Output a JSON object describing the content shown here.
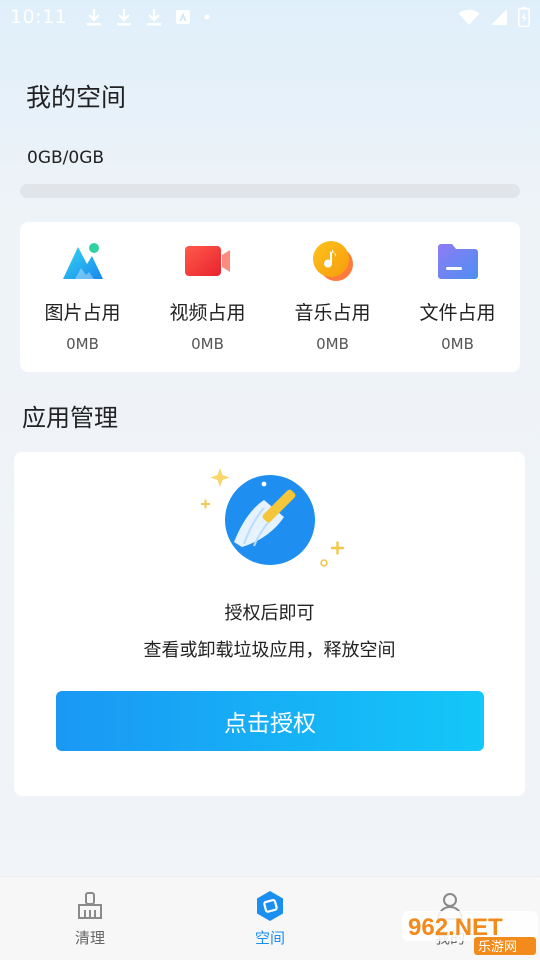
{
  "status_bar": {
    "time": "10:11",
    "left_icons": [
      "download-icon",
      "download-icon",
      "download-icon",
      "app-notification-icon",
      "dot-icon"
    ],
    "right_icons": [
      "wifi-icon",
      "signal-icon",
      "battery-charging-icon"
    ]
  },
  "page": {
    "title": "我的空间",
    "storage_text": "0GB/0GB",
    "storage_used_fraction": 0
  },
  "usage": {
    "items": [
      {
        "icon": "image-icon",
        "label": "图片占用",
        "value": "0MB",
        "color": "#21b3f0"
      },
      {
        "icon": "video-icon",
        "label": "视频占用",
        "value": "0MB",
        "color": "#f2423a"
      },
      {
        "icon": "music-icon",
        "label": "音乐占用",
        "value": "0MB",
        "color": "#f5b21a"
      },
      {
        "icon": "folder-icon",
        "label": "文件占用",
        "value": "0MB",
        "color": "#6b7ff0"
      }
    ]
  },
  "app_management": {
    "title": "应用管理",
    "line1": "授权后即可",
    "line2": "查看或卸载垃圾应用，释放空间",
    "button_label": "点击授权"
  },
  "bottom_nav": {
    "items": [
      {
        "icon": "broom-icon",
        "label": "清理",
        "active": false
      },
      {
        "icon": "space-icon",
        "label": "空间",
        "active": true
      },
      {
        "icon": "profile-icon",
        "label": "我的",
        "active": false
      }
    ]
  },
  "watermark": {
    "text": "962.NET",
    "subtext": "乐游网"
  },
  "colors": {
    "accent": "#1a8fef",
    "button_start": "#1a98f4",
    "button_end": "#13c7f8"
  }
}
